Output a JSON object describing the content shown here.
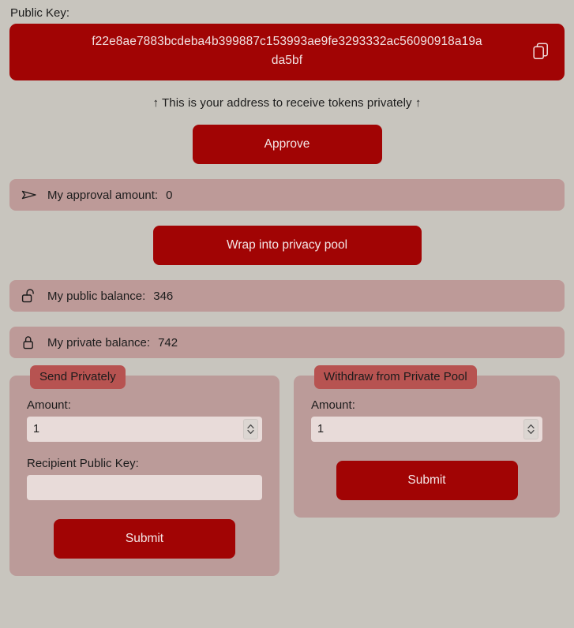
{
  "theme": {
    "page_background": "#c8c5be",
    "accent_red": "#a10404",
    "row_pink": "#bd9a98",
    "panel_pink": "#bb9b99",
    "legend_red": "#b75351",
    "input_bg": "#e8dbd9",
    "button_text": "#f4e7e7"
  },
  "public_key_section": {
    "label": "Public Key:",
    "value": "f22e8ae7883bcdeba4b399887c153993ae9fe3293332ac56090918a19ada5bf",
    "copy_icon": "copy-icon",
    "hint": "↑ This is your address to receive tokens privately ↑"
  },
  "actions": {
    "approve_label": "Approve",
    "wrap_label": "Wrap into privacy pool"
  },
  "info_rows": [
    {
      "icon": "send-icon",
      "label": "My approval amount:",
      "value": "0"
    },
    {
      "icon": "unlock-icon",
      "label": "My public balance:",
      "value": "346"
    },
    {
      "icon": "lock-icon",
      "label": "My private balance:",
      "value": "742"
    }
  ],
  "send_panel": {
    "legend": "Send Privately",
    "amount_label": "Amount:",
    "amount_value": "1",
    "amount_placeholder": "",
    "recipient_label": "Recipient Public Key:",
    "recipient_value": "",
    "recipient_placeholder": "",
    "submit_label": "Submit"
  },
  "withdraw_panel": {
    "legend": "Withdraw from Private Pool",
    "amount_label": "Amount:",
    "amount_value": "1",
    "amount_placeholder": "",
    "submit_label": "Submit"
  }
}
